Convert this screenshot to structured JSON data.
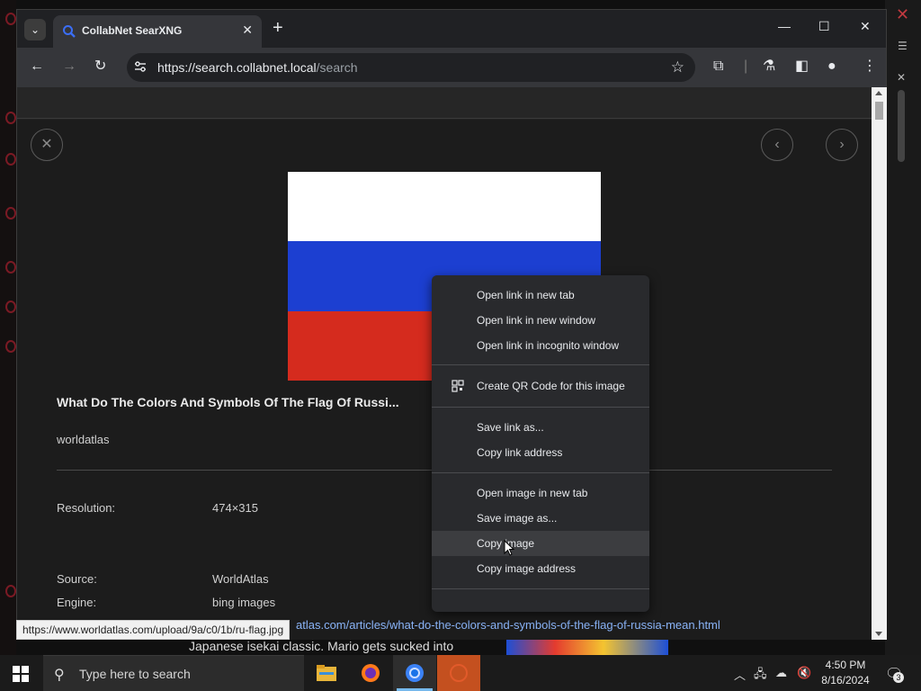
{
  "browser": {
    "tab_title": "CollabNet SearXNG",
    "tab_close": "✕",
    "new_tab": "+",
    "url_host": "https://search.collabnet.local",
    "url_path": "/search"
  },
  "icons": {
    "tab_search_list": "chevron-down-icon",
    "favicon": "search-icon",
    "back": "back-arrow-icon",
    "forward": "forward-arrow-icon",
    "reload": "reload-icon",
    "site_info": "site-settings-icon",
    "bookmark": "star-icon",
    "extensions": "puzzle-icon",
    "labs": "flask-icon",
    "side_panel": "side-panel-icon",
    "profile": "person-icon",
    "menu": "kebab-menu-icon"
  },
  "result": {
    "title": "What Do The Colors And Symbols Of The Flag Of Russi...",
    "site": "worldatlas",
    "meta": [
      {
        "label": "Resolution:",
        "value": "474×315"
      },
      {
        "label": "Source:",
        "value": "WorldAtlas"
      },
      {
        "label": "Engine:",
        "value": "bing images"
      }
    ],
    "link_tail": "atlas.com/articles/what-do-the-colors-and-symbols-of-the-flag-of-russia-mean.html",
    "flag_colors": [
      "#ffffff",
      "#1c3fd1",
      "#d52b1e"
    ]
  },
  "status_url": "https://www.worldatlas.com/upload/9a/c0/1b/ru-flag.jpg",
  "context_menu": {
    "items": [
      "Open link in new tab",
      "Open link in new window",
      "Open link in incognito window",
      "Create QR Code for this image",
      "Save link as...",
      "Copy link address",
      "Open image in new tab",
      "Save image as...",
      "Copy image",
      "Copy image address"
    ],
    "hovered": "Copy image"
  },
  "background_app": {
    "text": "Japanese isekai classic. Mario gets sucked into"
  },
  "taskbar": {
    "search_placeholder": "Type here to search",
    "time": "4:50 PM",
    "date": "8/16/2024",
    "notification_count": "3"
  },
  "colors": {
    "accent": "#8ab4f8",
    "menu_bg": "#292a2d",
    "detail_bg": "#1c1c1c"
  }
}
